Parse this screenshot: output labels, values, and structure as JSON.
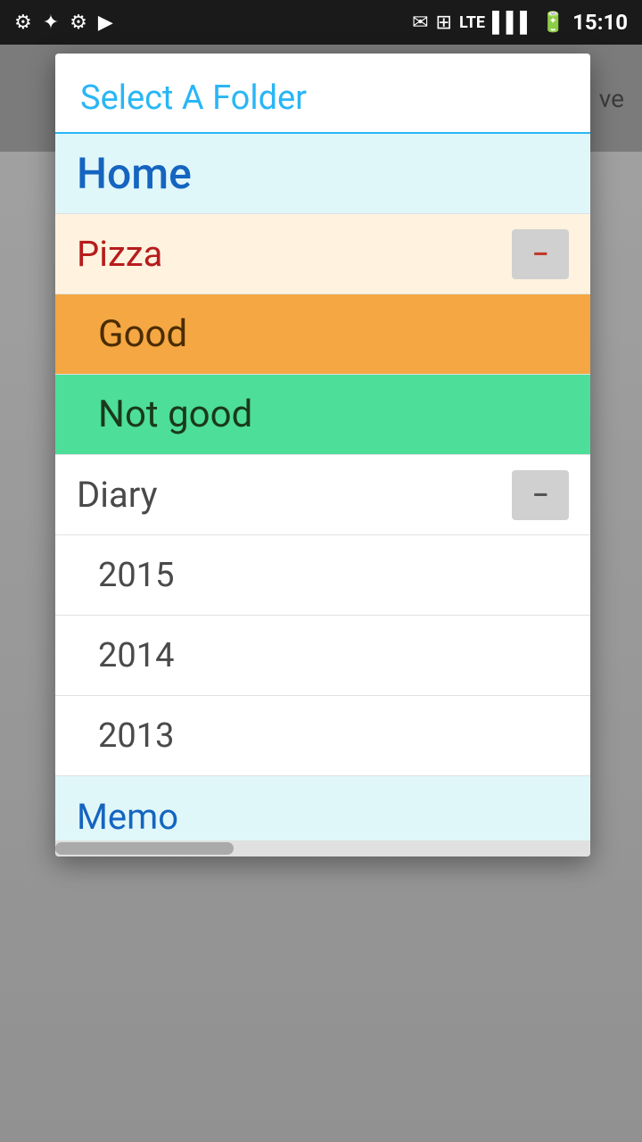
{
  "statusBar": {
    "time": "15:10",
    "icons": [
      "usb",
      "android",
      "usb2",
      "video",
      "mail",
      "photo",
      "lte",
      "signal",
      "battery"
    ]
  },
  "modal": {
    "title": "Select A Folder",
    "items": [
      {
        "id": "home",
        "label": "Home",
        "type": "home",
        "hasCollapse": false
      },
      {
        "id": "pizza",
        "label": "Pizza",
        "type": "pizza",
        "hasCollapse": true,
        "collapseColor": "red"
      },
      {
        "id": "good",
        "label": "Good",
        "type": "good",
        "hasCollapse": false
      },
      {
        "id": "notgood",
        "label": "Not good",
        "type": "notgood",
        "hasCollapse": false
      },
      {
        "id": "diary",
        "label": "Diary",
        "type": "diary",
        "hasCollapse": true,
        "collapseColor": "dark"
      },
      {
        "id": "2015",
        "label": "2015",
        "type": "sub",
        "hasCollapse": false
      },
      {
        "id": "2014",
        "label": "2014",
        "type": "sub",
        "hasCollapse": false
      },
      {
        "id": "2013",
        "label": "2013",
        "type": "sub",
        "hasCollapse": false
      },
      {
        "id": "memo",
        "label": "Memo",
        "type": "memo",
        "hasCollapse": false
      }
    ],
    "collapseSymbol": "–",
    "scrollbarThumbLeft": "0"
  },
  "background": {
    "topBannerText": "ve"
  }
}
